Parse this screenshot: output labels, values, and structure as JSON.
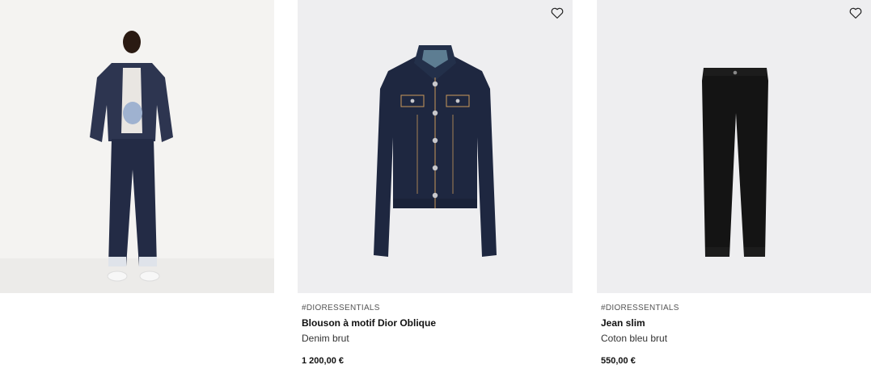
{
  "products": [
    {
      "tag": "#DIORESSENTIALS",
      "title": "Blouson à motif Dior Oblique",
      "subtitle": "Denim brut",
      "price": "1 200,00 €"
    },
    {
      "tag": "#DIORESSENTIALS",
      "title": "Jean slim",
      "subtitle": "Coton bleu brut",
      "price": "550,00 €"
    }
  ],
  "icons": {
    "favorite": "heart-outline-icon"
  },
  "colors": {
    "tile_bg": "#eeeef0",
    "look_bg": "#f3f2f0",
    "denim": "#1e2740",
    "black_jeans": "#141414"
  }
}
